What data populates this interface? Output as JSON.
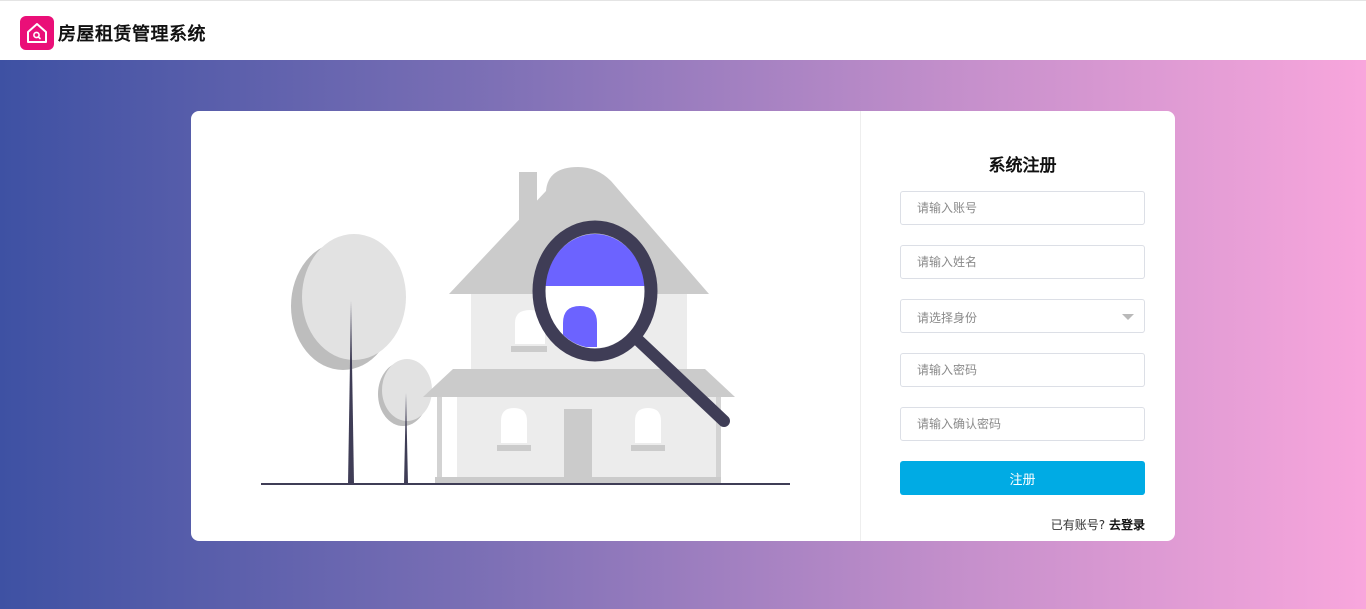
{
  "header": {
    "app_title": "房屋租赁管理系统",
    "icon": "house-icon"
  },
  "colors": {
    "brand": "#ea0f78",
    "primary_button": "#00abe4",
    "gradient_start": "#3e51a3",
    "gradient_end": "#f8a6dc",
    "illustration_accent": "#6c63ff"
  },
  "form": {
    "title": "系统注册",
    "account_placeholder": "请输入账号",
    "name_placeholder": "请输入姓名",
    "role_placeholder": "请选择身份",
    "password_placeholder": "请输入密码",
    "confirm_placeholder": "请输入确认密码",
    "submit_label": "注册",
    "login_prompt": "已有账号?",
    "login_link": "去登录"
  },
  "illustration": {
    "icon": "house-search-illustration"
  }
}
